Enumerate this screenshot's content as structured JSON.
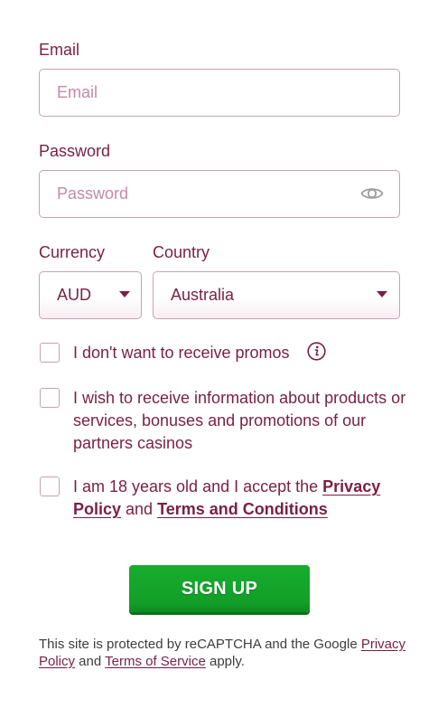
{
  "email": {
    "label": "Email",
    "placeholder": "Email",
    "value": ""
  },
  "password": {
    "label": "Password",
    "placeholder": "Password",
    "value": "",
    "toggle_icon": "eye-icon"
  },
  "currency": {
    "label": "Currency",
    "selected": "AUD"
  },
  "country": {
    "label": "Country",
    "selected": "Australia"
  },
  "checkboxes": {
    "no_promos": {
      "text": "I don't want to receive promos",
      "checked": false,
      "info_icon": "info-icon"
    },
    "partner_info": {
      "text": "I wish to receive information about products or services, bonuses and promotions of our partners casinos",
      "checked": false
    },
    "age_terms": {
      "text_before": "I am 18 years old and I accept the ",
      "privacy_link": "Privacy Policy",
      "text_and": " and ",
      "terms_link": "Terms and Conditions",
      "checked": false
    }
  },
  "signup_button": {
    "label": "SIGN UP"
  },
  "recaptcha": {
    "text_before": "This site is protected by reCAPTCHA and the Google ",
    "privacy_link": "Privacy Policy",
    "text_and": " and ",
    "terms_link": "Terms of Service",
    "text_after": " apply."
  },
  "colors": {
    "primary": "#7a1f44",
    "border": "#c7a2b5",
    "placeholder": "#c48aa8",
    "button_green": "#129f28"
  }
}
